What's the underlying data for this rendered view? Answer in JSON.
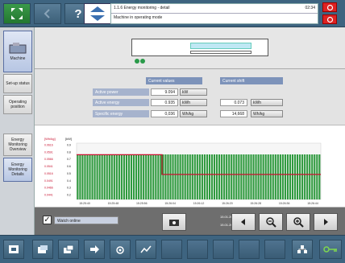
{
  "header": {
    "title": "1.1.6 Energy monitoring - detail",
    "time": "02:34",
    "status": "Machine in operating mode"
  },
  "sidebar": {
    "items": [
      {
        "label": "Machine"
      },
      {
        "label": "Set-up status"
      },
      {
        "label": "Operating position"
      },
      {
        "label": "Energy Monitoring Overview"
      },
      {
        "label": "Energy Monitoring Details"
      }
    ]
  },
  "values": {
    "col1": "Current values",
    "col2": "Current shift",
    "rows": [
      {
        "label": "Active power",
        "value": "9.094",
        "unit": "kW",
        "shift_value": "",
        "shift_unit": ""
      },
      {
        "label": "Active energy",
        "value": "0.935",
        "unit": "kWh",
        "shift_value": "0.073",
        "shift_unit": "kWh"
      },
      {
        "label": "Specific energy",
        "value": "0,036",
        "unit": "Wh/kg",
        "shift_value": "14,668",
        "shift_unit": "Wh/kg"
      }
    ]
  },
  "chart_controls": {
    "live_label": "Watch online",
    "time_from": "15.01.2015 - 15:26:25",
    "time_to": "15.01.2015 - 15:28:15"
  },
  "chart_data": {
    "type": "bar",
    "y1_label": "[Wh/kg]",
    "y2_label": "[kW]",
    "y1_ticks": [
      "0.0616",
      "0.0591",
      "0.0566",
      "0.0541",
      "0.0516",
      "0.0491",
      "0.0466",
      "0.0441"
    ],
    "y2_ticks": [
      "0.9",
      "0.8",
      "0.7",
      "0.6",
      "0.5",
      "0.4",
      "0.3",
      "0.2"
    ],
    "x_ticks": [
      "15:25:40",
      "15:25:48",
      "15:25:56",
      "15:26:04",
      "15:26:12",
      "15:26:20",
      "15:26:28",
      "15:26:36",
      "15:26:44"
    ],
    "bar_value": 0.8,
    "line_series": [
      {
        "from": 0,
        "to": 0.35,
        "value": 0.0581
      },
      {
        "from": 0.35,
        "to": 1,
        "value": 0.0512
      }
    ],
    "colors": {
      "bars": "#2e9a3e",
      "line": "#c8102e"
    }
  },
  "colors": {
    "topbar": "#3e6480",
    "accent": "#7d93ba"
  }
}
